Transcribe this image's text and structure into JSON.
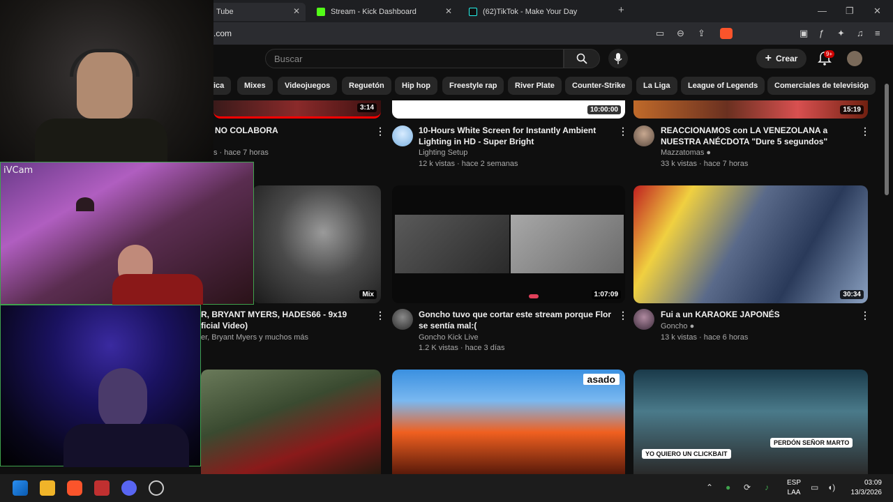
{
  "browser": {
    "tabs": [
      {
        "label": "Tube",
        "active": true,
        "icon": "youtube-icon"
      },
      {
        "label": "Stream - Kick Dashboard",
        "active": false,
        "icon": "kick-icon"
      },
      {
        "label": "(62)TikTok - Make Your Day",
        "active": false,
        "icon": "tiktok-icon"
      }
    ],
    "new_tab": "+",
    "url": ".com",
    "window": {
      "minimize": "—",
      "maximize": "❐",
      "close": "✕"
    }
  },
  "youtube": {
    "search_placeholder": "Buscar",
    "create_label": "Crear",
    "notif_badge": "9+",
    "chips": [
      "ica",
      "Mixes",
      "Videojuegos",
      "Reguetón",
      "Hip hop",
      "Freestyle rap",
      "River Plate",
      "Counter-Strike",
      "La Liga",
      "League of Legends",
      "Comerciales de televisión"
    ],
    "videos": [
      {
        "title": "NO COLABORA",
        "title2": "",
        "channel": "",
        "meta": "s · hace 7 horas",
        "duration": "3:14"
      },
      {
        "title": "10-Hours White Screen for Instantly Ambient",
        "title2": "Lighting in HD - Super Bright",
        "channel": "Lighting Setup",
        "meta": "12 k vistas · hace 2 semanas",
        "duration": "10:00:00"
      },
      {
        "title": "REACCIONAMOS con LA VENEZOLANA a",
        "title2": "NUESTRA ANÉCDOTA \"Dure 5 segundos\"",
        "channel": "Mazzatomas",
        "meta": "33 k vistas · hace 7 horas",
        "duration": "15:19"
      },
      {
        "title": "R, BRYANT MYERS, HADES66 - 9x19",
        "title2": "ficial Video)",
        "channel": "er, Bryant Myers y muchos más",
        "meta": "",
        "duration": "Mix"
      },
      {
        "title": "Goncho tuvo que cortar este stream porque Flor",
        "title2": "se sentía mal:(",
        "channel": "Goncho Kick Live",
        "meta": "1.2 K vistas · hace 3 días",
        "duration": "1:07:09"
      },
      {
        "title": "Fui a un KARAOKE JAPONÉS",
        "title2": "",
        "channel": "Goncho",
        "meta": "13 k vistas · hace 6 horas",
        "duration": "30:34"
      }
    ],
    "thumb_texts": {
      "asado": "asado",
      "clickbait": "YO QUIERO UN CLICKBAIT",
      "perdon": "PERDÓN SEÑOR MARTO"
    }
  },
  "overlay": {
    "cam_label": "iVCam"
  },
  "taskbar": {
    "lang1": "ESP",
    "lang2": "LAA",
    "time": "03:09",
    "date": "13/3/2026"
  },
  "colors": {
    "accent_red": "#cc0000",
    "cam_border": "#3fa34d",
    "kick_green": "#53fc18"
  }
}
